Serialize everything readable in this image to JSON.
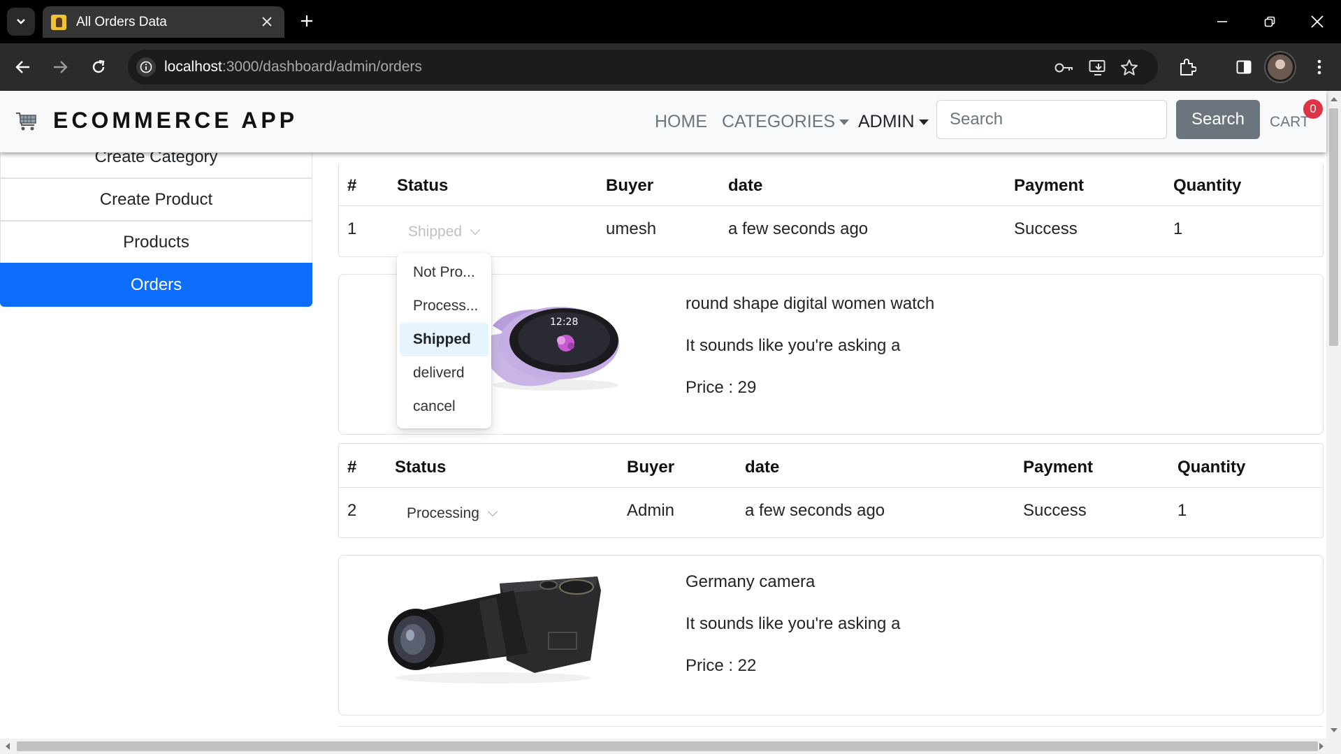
{
  "browser": {
    "tab_title": "All Orders Data",
    "url_host": "localhost",
    "url_path": ":3000/dashboard/admin/orders"
  },
  "header": {
    "brand": "ECOMMERCE APP",
    "nav": {
      "home": "HOME",
      "categories": "CATEGORIES",
      "admin": "ADMIN"
    },
    "search_placeholder": "Search",
    "search_button": "Search",
    "cart_label": "CART",
    "cart_count": "0"
  },
  "sidebar": {
    "items": [
      {
        "label": "Create Category"
      },
      {
        "label": "Create Product"
      },
      {
        "label": "Products"
      },
      {
        "label": "Orders"
      }
    ]
  },
  "table_headers": {
    "num": "#",
    "status": "Status",
    "buyer": "Buyer",
    "date": "date",
    "payment": "Payment",
    "quantity": "Quantity"
  },
  "orders": [
    {
      "num": "1",
      "status": "Shipped",
      "buyer": "umesh",
      "date": "a few seconds ago",
      "payment": "Success",
      "quantity": "1",
      "product": {
        "name": "round shape digital women watch",
        "description": "It sounds like you're asking a",
        "price": "Price : 29",
        "watch_time": "12:28"
      }
    },
    {
      "num": "2",
      "status": "Processing",
      "buyer": "Admin",
      "date": "a few seconds ago",
      "payment": "Success",
      "quantity": "1",
      "product": {
        "name": "Germany camera",
        "description": "It sounds like you're asking a",
        "price": "Price : 22"
      }
    }
  ],
  "status_dropdown": {
    "options": [
      "Not Pro...",
      "Process...",
      "Shipped",
      "deliverd",
      "cancel"
    ],
    "selected": "Shipped"
  },
  "colors": {
    "active_blue": "#0d6efd",
    "badge_red": "#dc3545",
    "search_btn": "#6c757d",
    "dropdown_selected": "#e6f4ff"
  },
  "icons": [
    "chevron-down-icon",
    "close-icon",
    "plus-icon",
    "back-arrow-icon",
    "forward-arrow-icon",
    "reload-icon",
    "info-icon",
    "key-icon",
    "install-icon",
    "star-icon",
    "extensions-icon",
    "sidepanel-icon",
    "menu-dots-icon",
    "cart-icon"
  ]
}
